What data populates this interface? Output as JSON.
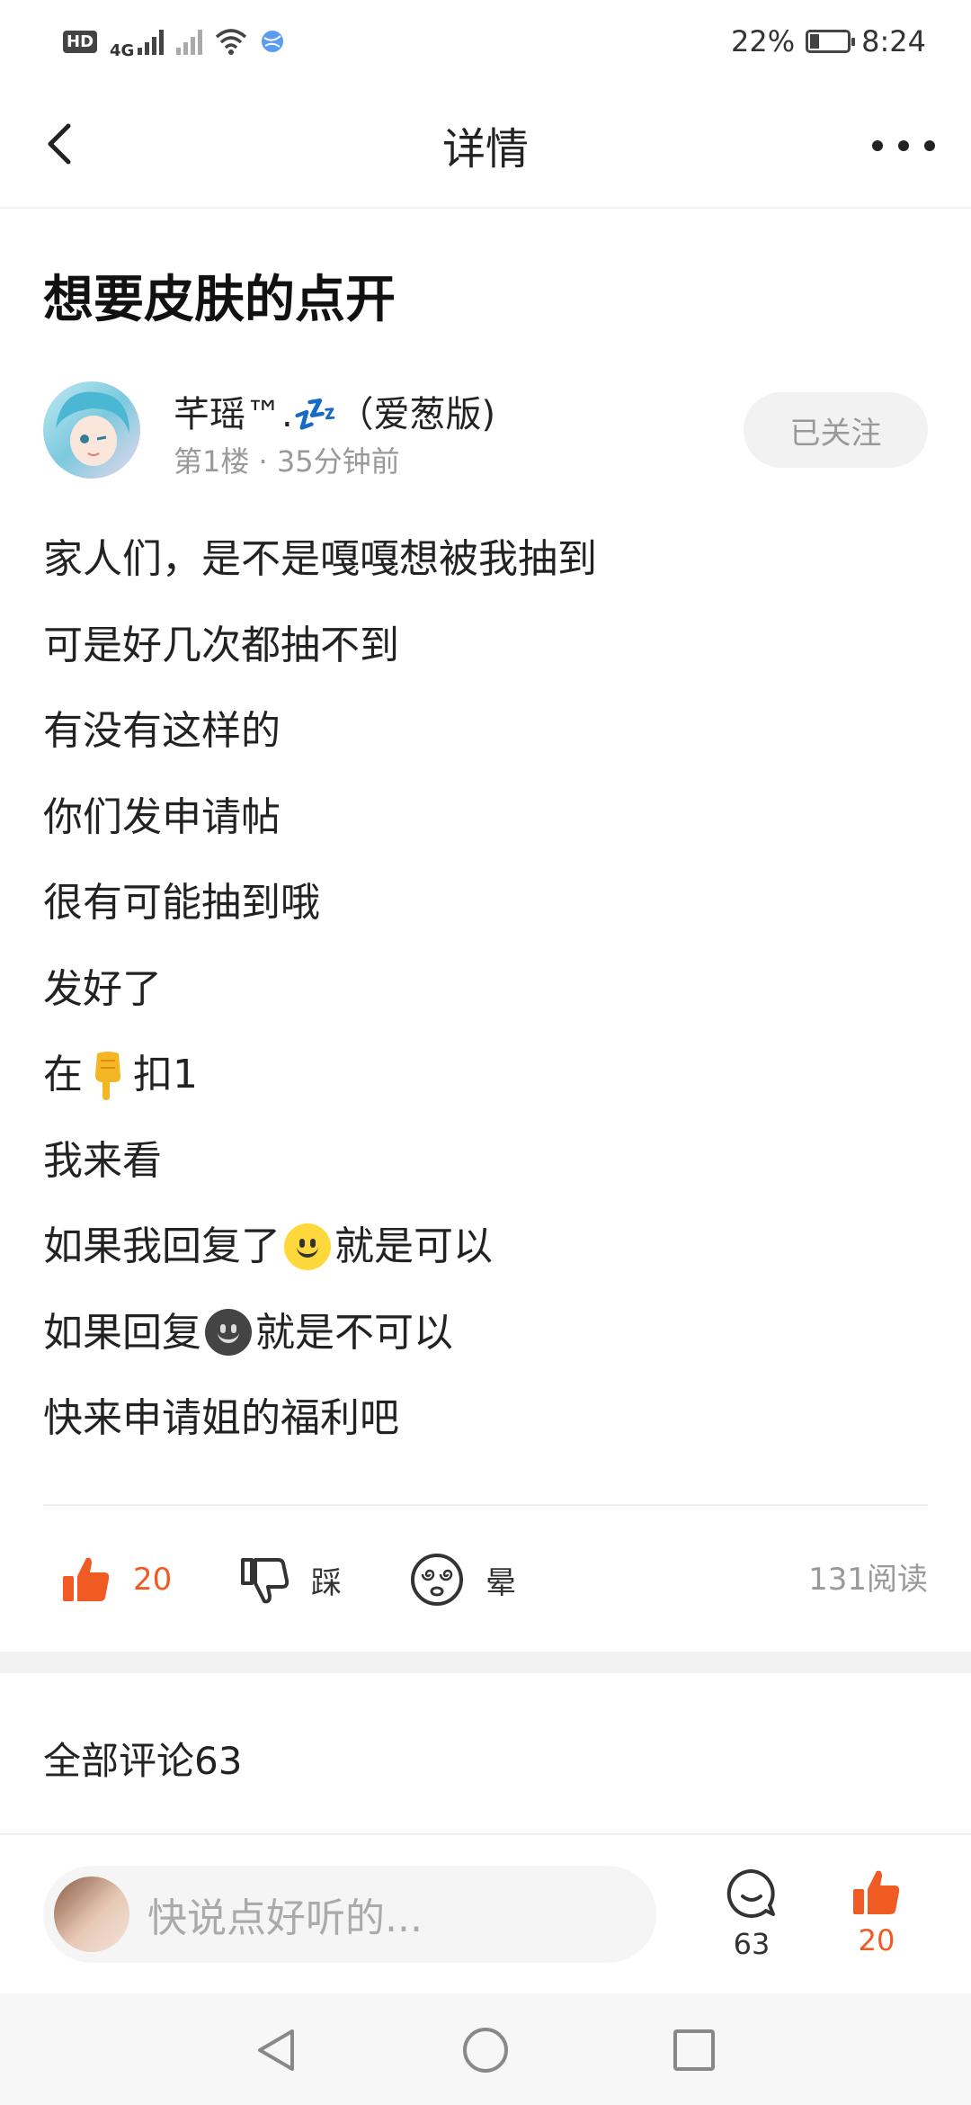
{
  "status_bar": {
    "left": {
      "hd": "HD",
      "network": "4G"
    },
    "battery": "22%",
    "time": "8:24"
  },
  "header": {
    "title": "详情"
  },
  "post": {
    "title": "想要皮肤的点开",
    "author": {
      "name": "芊瑶™.💤（爱葱版)",
      "meta": "第1楼 · 35分钟前",
      "follow_label": "已关注"
    },
    "lines": [
      "家人们，是不是嘎嘎想被我抽到",
      "可是好几次都抽不到",
      "有没有这样的",
      "你们发申请帖",
      "很有可能抽到哦",
      "发好了",
      {
        "before": "在",
        "icon": "pointing-down-hand-icon",
        "after": "扣1"
      },
      "我来看",
      {
        "before": "如果我回复了",
        "icon": "slightly-smiling-face-icon",
        "after": "就是可以"
      },
      {
        "before": "如果回复",
        "icon": "dark-smiling-face-icon",
        "after": "就是不可以"
      },
      "快来申请姐的福利吧"
    ]
  },
  "actions": {
    "like_count": "20",
    "dislike_label": "踩",
    "dizzy_label": "晕",
    "read_count": "131阅读"
  },
  "comments": {
    "title": "全部评论63"
  },
  "bottom_bar": {
    "placeholder": "快说点好听的...",
    "comment_count": "63",
    "like_count": "20"
  },
  "icons": {
    "back": "chevron-left-icon",
    "more": "more-dots-icon",
    "like": "thumbs-up-icon",
    "dislike": "thumbs-down-icon",
    "dizzy": "dizzy-face-icon",
    "comment": "comment-bubble-icon"
  },
  "colors": {
    "accent": "#f05a23",
    "muted": "#999999",
    "divider": "#eeeeee"
  }
}
